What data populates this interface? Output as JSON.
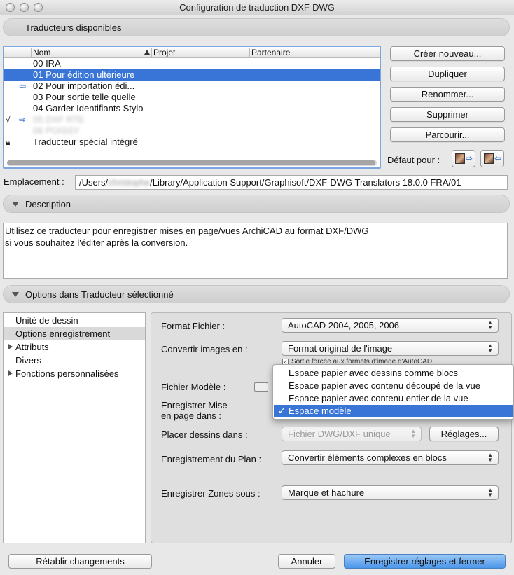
{
  "window": {
    "title": "Configuration de traduction DXF-DWG"
  },
  "sections": {
    "available": "Traducteurs disponibles",
    "description": "Description",
    "options": "Options dans Traducteur sélectionné"
  },
  "list": {
    "columns": {
      "name": "Nom",
      "project": "Projet",
      "partner": "Partenaire"
    },
    "rows": [
      {
        "label": "00 IRA"
      },
      {
        "label": "01 Pour édition ultérieure"
      },
      {
        "label": "02 Pour importation édi..."
      },
      {
        "label": "03 Pour sortie telle quelle"
      },
      {
        "label": "04 Garder Identifiants Stylo"
      },
      {
        "label": "05 DXF RTE"
      },
      {
        "label": "06 POISSY"
      },
      {
        "label": "Traducteur spécial intégré"
      }
    ]
  },
  "buttons": {
    "create": "Créer nouveau...",
    "duplicate": "Dupliquer",
    "rename": "Renommer...",
    "delete": "Supprimer",
    "browse": "Parcourir...",
    "default_for": "Défaut pour :"
  },
  "location": {
    "label": "Emplacement :",
    "prefix": "/Users/",
    "user": "christophe",
    "suffix": "/Library/Application Support/Graphisoft/DXF-DWG Translators 18.0.0 FRA/01"
  },
  "description": {
    "line1": "Utilisez ce traducteur pour enregistrer mises en page/vues ArchiCAD au format DXF/DWG",
    "line2": "si vous souhaitez l'éditer après la conversion."
  },
  "left_items": [
    {
      "label": "Unité de dessin"
    },
    {
      "label": "Options enregistrement"
    },
    {
      "label": "Attributs"
    },
    {
      "label": "Divers"
    },
    {
      "label": "Fonctions personnalisées"
    }
  ],
  "options": {
    "format_label": "Format Fichier :",
    "format_value": "AutoCAD 2004, 2005, 2006",
    "convert_label": "Convertir images en :",
    "convert_value": "Format original de l'image",
    "force_checkbox": "Sortie forcée aux formats d'image d'AutoCAD",
    "model_label": "Fichier Modèle :",
    "save_layout_label_1": "Enregistrer Mise",
    "save_layout_label_2": "en page dans :",
    "place_label": "Placer dessins dans :",
    "place_value": "Fichier DWG/DXF unique",
    "settings": "Réglages...",
    "plan_label": "Enregistrement du Plan :",
    "plan_value": "Convertir éléments complexes en blocs",
    "zones_label": "Enregistrer Zones sous :",
    "zones_value": "Marque et hachure"
  },
  "dropdown": {
    "items": [
      {
        "label": "Espace papier avec dessins comme blocs"
      },
      {
        "label": "Espace papier avec contenu découpé de la vue"
      },
      {
        "label": "Espace papier avec contenu entier de la vue"
      },
      {
        "label": "Espace modèle"
      }
    ],
    "check": "✓"
  },
  "footer": {
    "revert": "Rétablir changements",
    "cancel": "Annuler",
    "save": "Enregistrer réglages et fermer"
  },
  "colors": {
    "selection": "#3875d7",
    "focus_ring": "#7aa7e0"
  }
}
